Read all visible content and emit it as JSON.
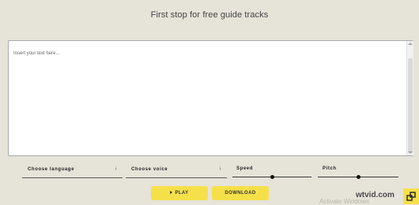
{
  "header": {
    "tagline": "First stop for free guide tracks"
  },
  "editor": {
    "placeholder": "Insert your text here..."
  },
  "controls": {
    "language": {
      "label": "Choose language",
      "arrow": "↓"
    },
    "voice": {
      "label": "Choose voice",
      "arrow": "↓"
    },
    "speed": {
      "label": "Speed",
      "value_fraction": 0.5
    },
    "pitch": {
      "label": "Pitch",
      "value_fraction": 0.5
    }
  },
  "actions": {
    "play_label": "PLAY",
    "download_label": "DOWNLOAD"
  },
  "overlay": {
    "activate_text": "Activate Windows",
    "site_watermark": "wtvid.com"
  },
  "colors": {
    "background": "#e6e3d9",
    "button_yellow": "#f6e04a"
  },
  "icons": {
    "play": "play-icon",
    "corner": "link-icon"
  }
}
